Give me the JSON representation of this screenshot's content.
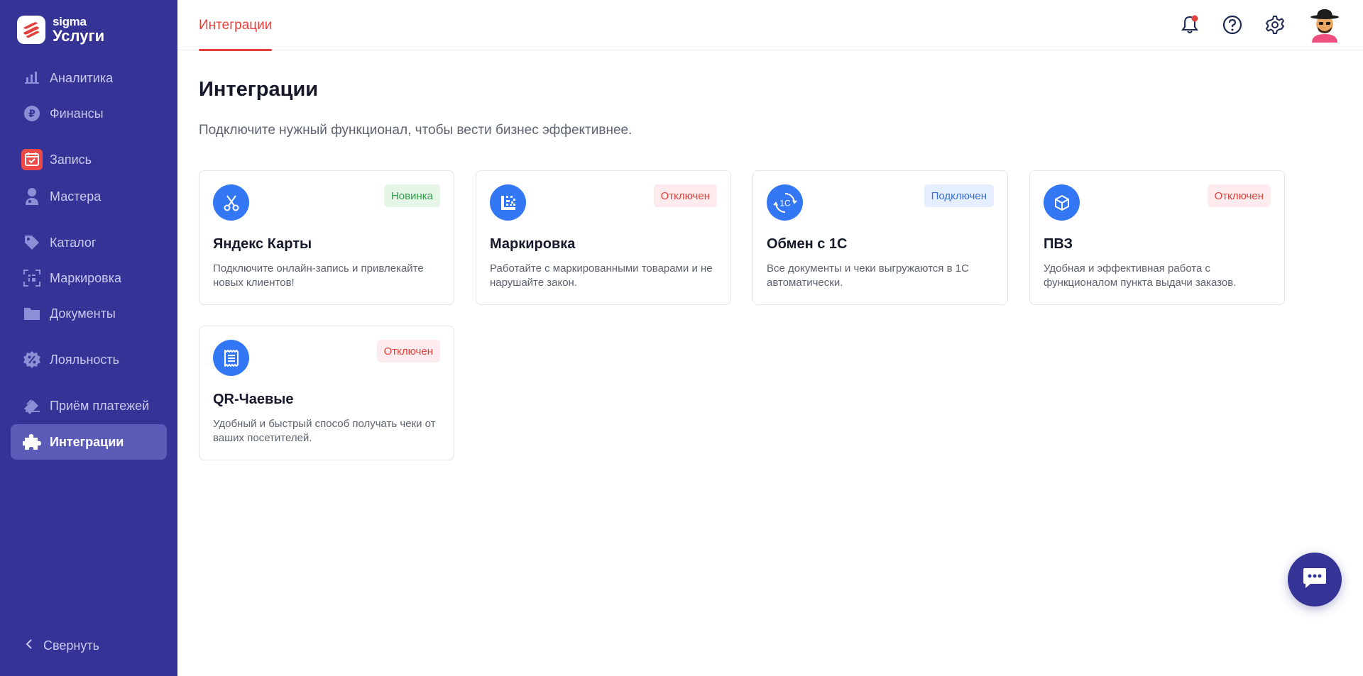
{
  "brand": {
    "top": "sigma",
    "bottom": "Услуги"
  },
  "sidebar": {
    "items": [
      {
        "label": "Аналитика",
        "icon": "bar-chart-icon"
      },
      {
        "label": "Финансы",
        "icon": "ruble-icon"
      },
      {
        "label": "Запись",
        "icon": "calendar-check-icon"
      },
      {
        "label": "Мастера",
        "icon": "master-icon"
      },
      {
        "label": "Каталог",
        "icon": "tag-icon"
      },
      {
        "label": "Маркировка",
        "icon": "datamatrix-scan-icon"
      },
      {
        "label": "Документы",
        "icon": "folder-icon"
      },
      {
        "label": "Лояльность",
        "icon": "percent-badge-icon"
      },
      {
        "label": "Приём платежей",
        "icon": "card-stack-icon"
      },
      {
        "label": "Интеграции",
        "icon": "puzzle-icon",
        "active": true
      }
    ],
    "collapse_label": "Свернуть"
  },
  "topbar": {
    "tab": "Интеграции",
    "icons": [
      "bell-icon",
      "help-icon",
      "gear-icon",
      "avatar"
    ]
  },
  "main": {
    "title": "Интеграции",
    "subtitle": "Подключите нужный функционал, чтобы вести бизнес эффективнее.",
    "cards": [
      {
        "title": "Яндекс Карты",
        "badge": "Новинка",
        "status": "new",
        "desc": "Подключите онлайн-запись и привлекайте новых клиентов!",
        "icon": "scissors-icon"
      },
      {
        "title": "Маркировка",
        "badge": "Отключен",
        "status": "off",
        "desc": "Работайте с маркированными товарами и не нарушайте закон.",
        "icon": "datamatrix-icon"
      },
      {
        "title": "Обмен с 1С",
        "badge": "Подключен",
        "status": "on",
        "desc": "Все документы и чеки выгружаются в 1С автоматически.",
        "icon": "1c-sync-icon",
        "icon_text": "1C"
      },
      {
        "title": "ПВЗ",
        "badge": "Отключен",
        "status": "off",
        "desc": "Удобная и эффективная работа с функционалом пункта выдачи заказов.",
        "icon": "box-icon"
      },
      {
        "title": "QR-Чаевые",
        "badge": "Отключен",
        "status": "off",
        "desc": "Удобный и быстрый способ получать чеки от ваших посетителей.",
        "icon": "receipt-icon"
      }
    ]
  },
  "colors": {
    "sidebar_bg": "#353396",
    "sidebar_active": "#5c5bb8",
    "accent_red": "#e3423c",
    "icon_blue": "#3377f5"
  }
}
